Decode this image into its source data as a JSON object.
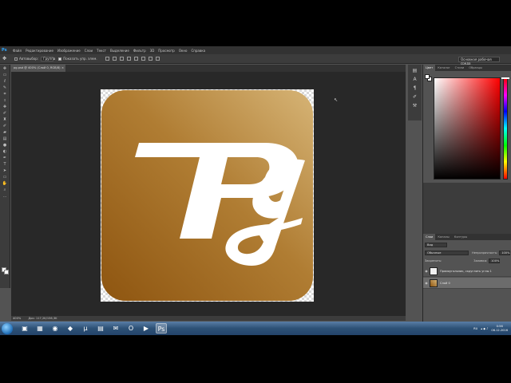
{
  "menu": {
    "app_logo": "Ps",
    "items": [
      "Файл",
      "Редактирование",
      "Изображение",
      "Слои",
      "Текст",
      "Выделение",
      "Фильтр",
      "3D",
      "Просмотр",
      "Окно",
      "Справка"
    ]
  },
  "options": {
    "autoselect_label": "Автовыбор:",
    "autoselect_target": "Группа",
    "transform_label": "Показать упр. элем."
  },
  "workspace": {
    "value": "Основная рабочая среда"
  },
  "document_tab": {
    "title": "pg.psd @ 400% (Слой 0, RGB/8)",
    "close": "×"
  },
  "status": {
    "zoom": "400%",
    "doc": "Док: 117,2K/156,3K"
  },
  "color_panel": {
    "tabs": [
      "Цвет",
      "Каталог",
      "Стили",
      "Образцы"
    ]
  },
  "layers_panel": {
    "tabs": [
      "Слои",
      "Каналы",
      "Контуры"
    ],
    "filter_label": "Вид",
    "blend_mode": "Обычные",
    "opacity_label": "Непрозрачность:",
    "opacity_value": "100%",
    "lock_label": "Закрепить:",
    "fill_label": "Заливка:",
    "fill_value": "100%",
    "layers": [
      {
        "name": "Прямоугольник, скруглить углы 1",
        "thumb": "white",
        "selected": false
      },
      {
        "name": "Слой 0",
        "thumb": "gold",
        "selected": true
      }
    ]
  },
  "taskbar": {
    "lang": "RU",
    "time": "0:56",
    "date": "06.12.2016"
  },
  "colors": {
    "icon_light": "#d6b476",
    "icon_dark": "#8e5510"
  }
}
